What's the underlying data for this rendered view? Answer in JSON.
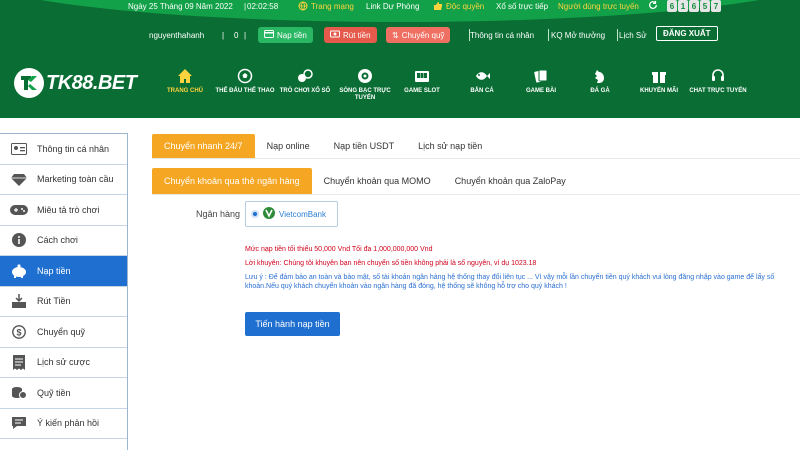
{
  "topbar": {
    "date": "Ngày 25 Tháng 09 Năm 2022",
    "time": "02:02:58",
    "network": "Trang mạng",
    "backup_link": "Link Dự Phòng",
    "exclusive": "Độc quyền",
    "lottery": "Xổ số trực tiếp",
    "online_users": "Người dùng trực tuyến",
    "online_count_digits": [
      "6",
      "1",
      "6",
      "5",
      "7"
    ]
  },
  "userbar": {
    "username": "nguyenthahanh",
    "balance": "0",
    "deposit": "Nạp tiền",
    "withdraw": "Rút tiền",
    "transfer": "Chuyển quỹ",
    "personal_info": "Thông tin cá nhân",
    "lottery_results": "KQ Mở thưởng",
    "history": "Lịch Sử",
    "logout": "ĐĂNG XUẤT"
  },
  "logo": {
    "text": "TK88.BET"
  },
  "nav": [
    {
      "label": "TRANG CHỦ",
      "icon": "home-icon"
    },
    {
      "label": "THỂ ĐẤU THỂ THAO",
      "icon": "soccer-ball-icon"
    },
    {
      "label": "TRÒ CHƠI XỔ SỐ",
      "icon": "lottery-balls-icon"
    },
    {
      "label": "SÒNG BẠC TRỰC TUYẾN",
      "icon": "casino-chip-icon"
    },
    {
      "label": "GAME SLOT",
      "icon": "slot-machine-icon"
    },
    {
      "label": "BẮN CÁ",
      "icon": "fish-icon"
    },
    {
      "label": "GAME BÀI",
      "icon": "cards-icon"
    },
    {
      "label": "ĐÁ GÀ",
      "icon": "rooster-icon"
    },
    {
      "label": "KHUYẾN MÃI",
      "icon": "gift-icon"
    },
    {
      "label": "CHAT TRỰC TUYẾN",
      "icon": "headset-icon"
    }
  ],
  "sidebar": [
    {
      "label": "Thông tin cá nhân",
      "icon": "id-card-icon"
    },
    {
      "label": "Marketing toàn cầu",
      "icon": "diamond-icon"
    },
    {
      "label": "Miêu tả trò chơi",
      "icon": "gamepad-icon"
    },
    {
      "label": "Cách chơi",
      "icon": "info-icon"
    },
    {
      "label": "Nạp tiền",
      "icon": "piggy-bank-icon"
    },
    {
      "label": "Rút Tiền",
      "icon": "withdraw-icon"
    },
    {
      "label": "Chuyển quỹ",
      "icon": "dollar-circle-icon"
    },
    {
      "label": "Lịch sử cược",
      "icon": "receipt-icon"
    },
    {
      "label": "Quỹ tiền",
      "icon": "coins-icon"
    },
    {
      "label": "Ý kiến phản hồi",
      "icon": "chat-icon"
    }
  ],
  "main": {
    "tabs": [
      "Chuyển nhanh 24/7",
      "Nạp online",
      "Nạp tiền USDT",
      "Lịch sử nạp tiền"
    ],
    "subtabs": [
      "Chuyển khoản qua thẻ ngân hàng",
      "Chuyển khoản qua MOMO",
      "Chuyển khoản qua ZaloPay"
    ],
    "bank_label": "Ngân hàng",
    "bank_name": "VietcomBank",
    "note_min": "Mức nạp tiền tối thiểu 50,000 Vnd Tối đa 1,000,000,000 Vnd",
    "note_advice": "Lời khuyên: Chúng tôi khuyên bạn nên chuyển số tiền không phải là số nguyên, ví dụ 1023.18",
    "note_warning": "Lưu ý : Để đảm bảo an toàn và bảo mật, số tài khoản ngân hàng hệ thống thay đổi liên tục ... Vì vậy mỗi lần chuyển tiền quý khách vui lòng đăng nhập vào game để lấy số khoản.Nếu quý khách chuyển khoản vào ngân hàng đã đóng, hệ thống sẽ không hỗ trợ cho quý khách !",
    "submit": "Tiến hành nạp tiền"
  },
  "colors": {
    "header_green": "#0a6e34",
    "accent_orange": "#f5a623",
    "primary_blue": "#1f6fd1",
    "gold": "#ffd33d"
  }
}
